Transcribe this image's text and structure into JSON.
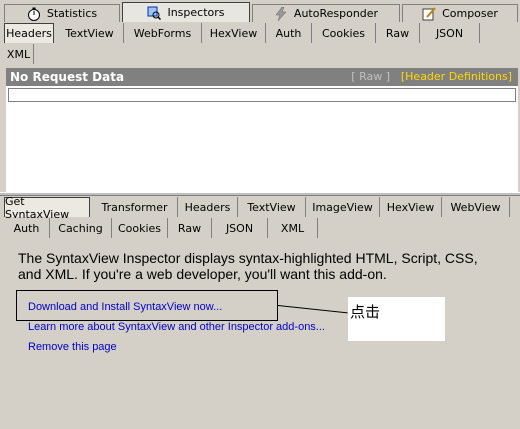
{
  "main_tabs": [
    {
      "label": "Statistics",
      "icon": "stopwatch-icon"
    },
    {
      "label": "Inspectors",
      "icon": "inspect-icon"
    },
    {
      "label": "AutoResponder",
      "icon": "lightning-icon"
    },
    {
      "label": "Composer",
      "icon": "pencil-icon"
    }
  ],
  "request_tabs": [
    "Headers",
    "TextView",
    "WebForms",
    "HexView",
    "Auth",
    "Cookies",
    "Raw",
    "JSON",
    "XML"
  ],
  "request_panel": {
    "title": "No Request Data",
    "raw_link": "[ Raw ]",
    "header_defs_link": "[Header Definitions]"
  },
  "response_tabs_row1": [
    "Get SyntaxView",
    "Transformer",
    "Headers",
    "TextView",
    "ImageView",
    "HexView",
    "WebView"
  ],
  "response_tabs_row2": [
    "Auth",
    "Caching",
    "Cookies",
    "Raw",
    "JSON",
    "XML"
  ],
  "syntaxview": {
    "message": "The SyntaxView Inspector displays syntax-highlighted HTML, Script, CSS, and XML. If you're a web developer, you'll want this add-on.",
    "download_link": "Download and Install SyntaxView now...",
    "learn_more_link": "Learn more about SyntaxView and other Inspector add-ons...",
    "remove_link": "Remove this page"
  },
  "annotation": {
    "note": "点击"
  },
  "colors": {
    "link": "#0000cc",
    "header_defs": "#ffd800",
    "panel_header": "#808080"
  }
}
